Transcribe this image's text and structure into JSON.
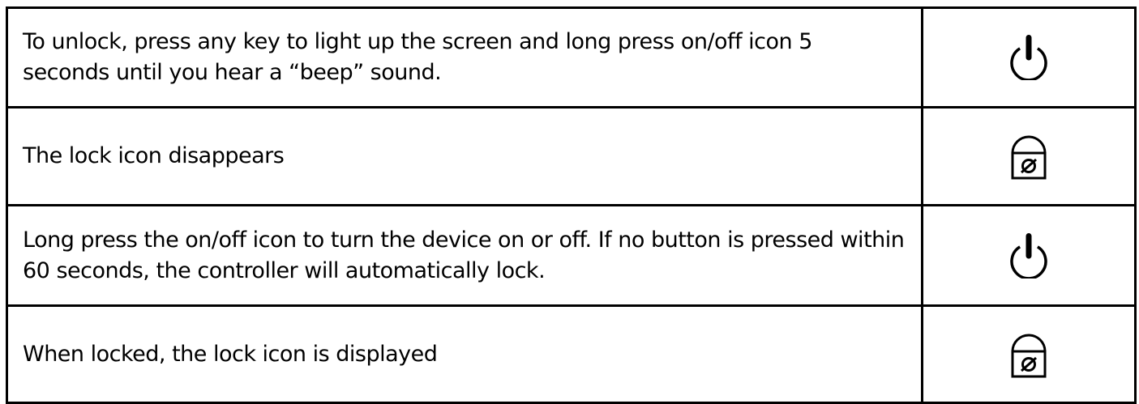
{
  "rows": [
    {
      "text": "To unlock, press any key to light up the screen and long press on/off icon 5 seconds until you hear a “beep” sound.",
      "icon": "power-icon"
    },
    {
      "text": "The lock icon disappears",
      "icon": "lock-icon"
    },
    {
      "text": "Long press the on/off icon to turn the device on or off. If no button is pressed within 60 seconds, the controller will automatically lock.",
      "icon": "power-icon"
    },
    {
      "text": "When locked, the lock icon is displayed",
      "icon": "lock-icon"
    }
  ]
}
